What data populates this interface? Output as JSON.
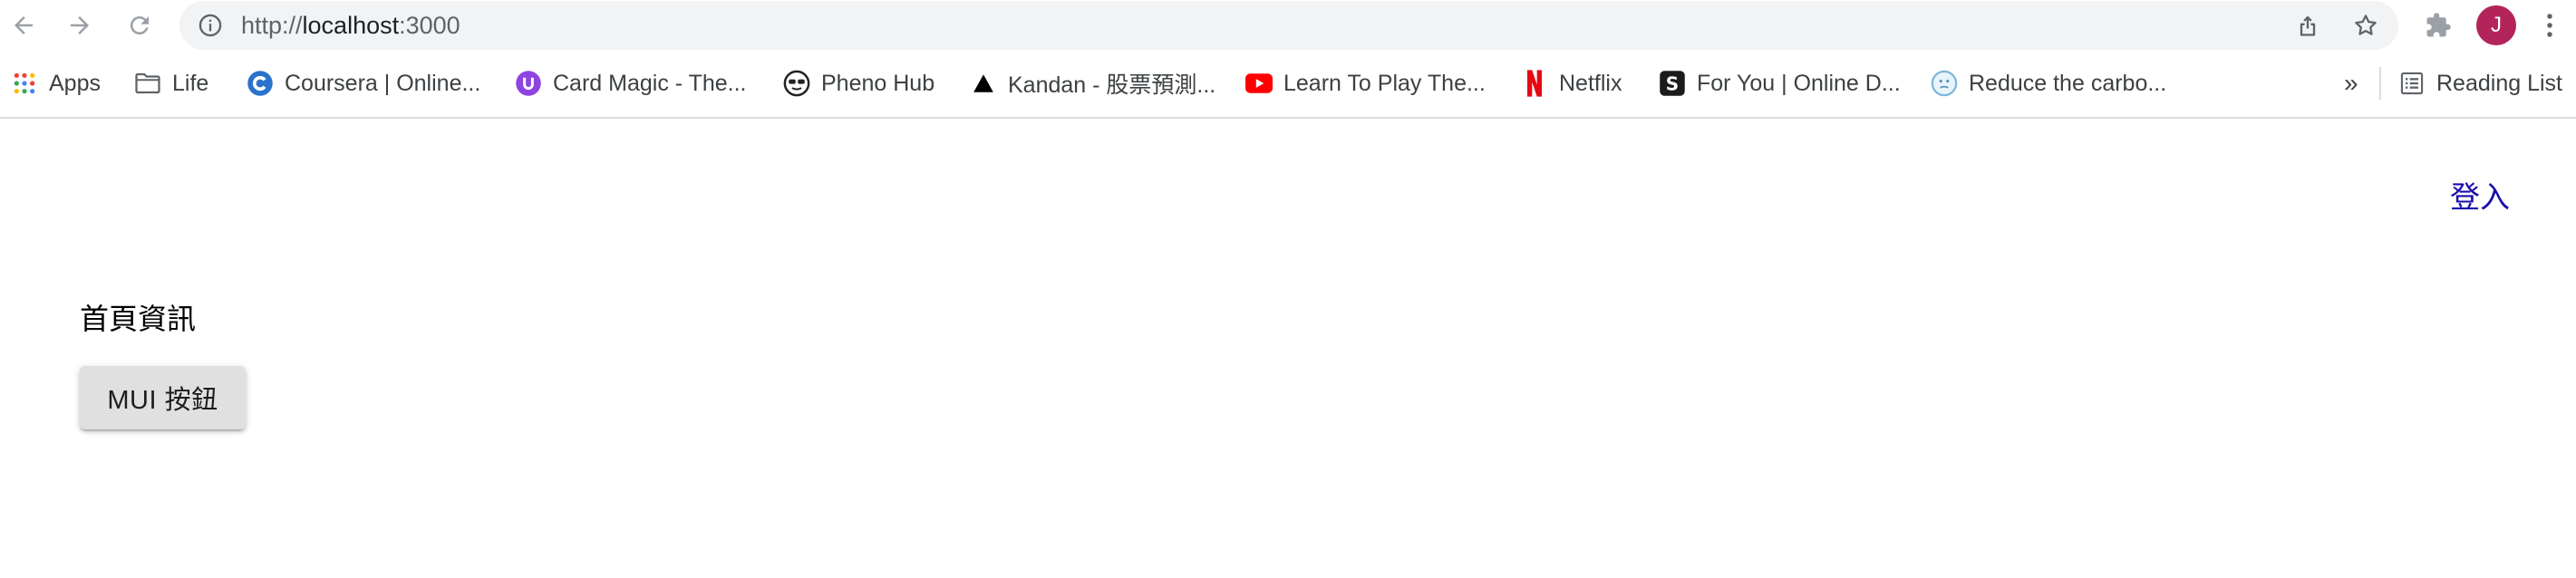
{
  "browser": {
    "url_scheme": "http://",
    "url_host": "localhost",
    "url_port": ":3000",
    "avatar_initial": "J"
  },
  "bookmarks": {
    "apps": "Apps",
    "life": "Life",
    "coursera": "Coursera | Online...",
    "cardmagic": "Card Magic - The...",
    "pheno": "Pheno Hub",
    "kandan": "Kandan - 股票預測...",
    "youtube": "Learn To Play The...",
    "netflix": "Netflix",
    "foryou": "For You | Online D...",
    "reduce": "Reduce the carbo...",
    "overflow": "»",
    "reading_list": "Reading List"
  },
  "page": {
    "login": "登入",
    "heading": "首頁資訊",
    "button": "MUI 按鈕"
  },
  "colors": {
    "omnibox_bg": "#f1f3f4",
    "avatar_bg": "#b3245a",
    "link": "#1a0dab",
    "mui_button_bg": "#e0e0e0"
  }
}
